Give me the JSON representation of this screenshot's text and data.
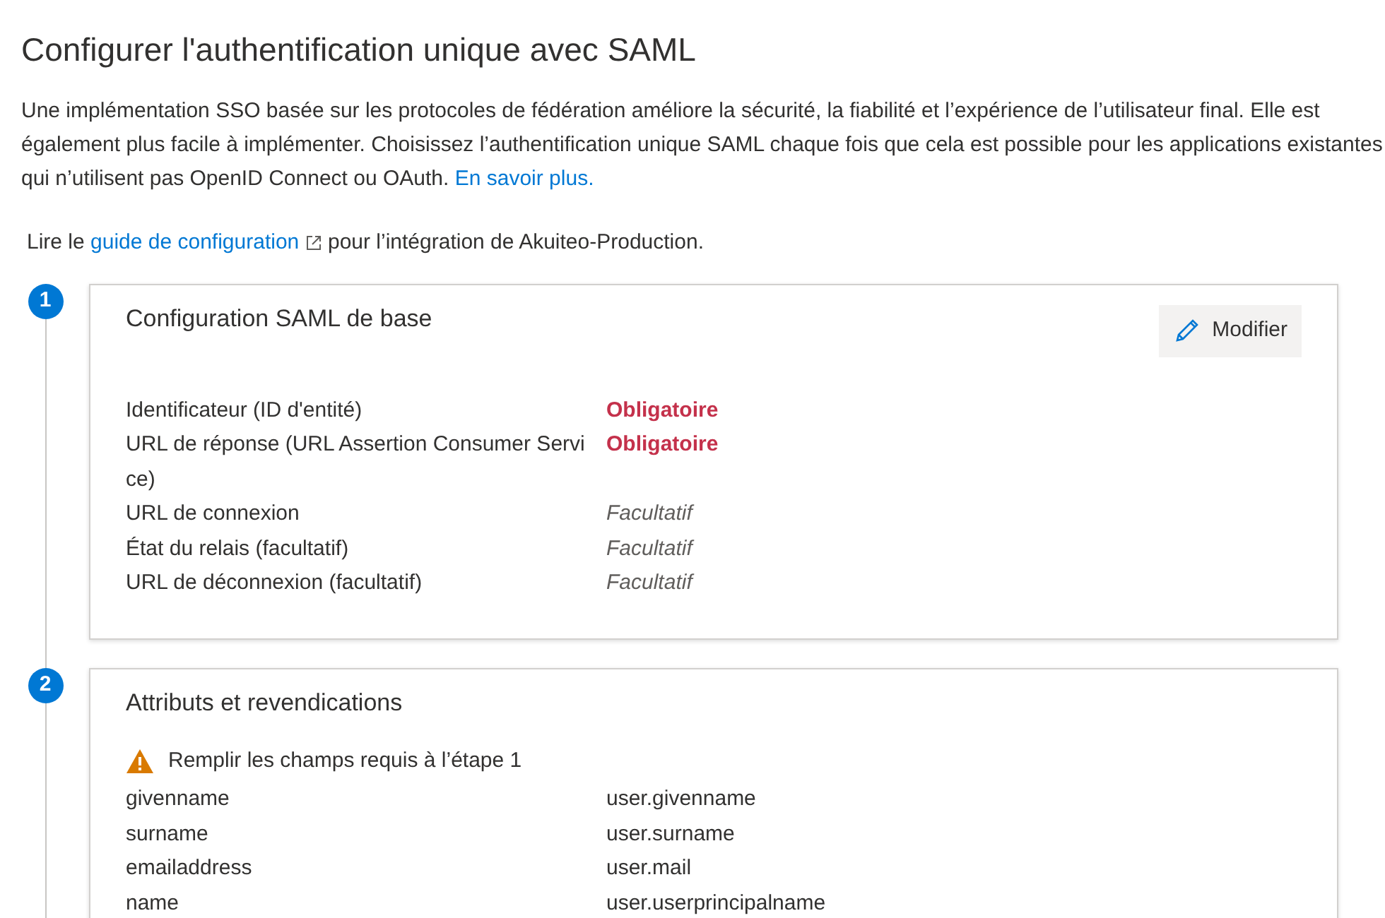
{
  "title": "Configurer l'authentification unique avec SAML",
  "description": {
    "text": "Une implémentation SSO basée sur les protocoles de fédération améliore la sécurité, la fiabilité et l’expérience de l’utilisateur final. Elle est également plus facile à implémenter. Choisissez l’authentification unique SAML chaque fois que cela est possible pour les applications existantes qui n’utilisent pas OpenID Connect ou OAuth.",
    "link": "En savoir plus."
  },
  "guide": {
    "before": "Lire le",
    "link": "guide de configuration",
    "after": "pour l’intégration de Akuiteo-Production."
  },
  "steps": [
    {
      "number": "1",
      "title": "Configuration SAML de base",
      "button": "Modifier",
      "rows": [
        {
          "label": "Identificateur (ID d'entité)",
          "value": "Obligatoire",
          "kind": "required"
        },
        {
          "label": "URL de réponse (URL Assertion Consumer Service)",
          "value": "Obligatoire",
          "kind": "required"
        },
        {
          "label": "URL de connexion",
          "value": "Facultatif",
          "kind": "optional"
        },
        {
          "label": "État du relais (facultatif)",
          "value": "Facultatif",
          "kind": "optional"
        },
        {
          "label": "URL de déconnexion (facultatif)",
          "value": "Facultatif",
          "kind": "optional"
        }
      ]
    },
    {
      "number": "2",
      "title": "Attributs et revendications",
      "warning": "Remplir les champs requis à l’étape 1",
      "rows": [
        {
          "label": "givenname",
          "value": "user.givenname",
          "kind": "plain"
        },
        {
          "label": "surname",
          "value": "user.surname",
          "kind": "plain"
        },
        {
          "label": "emailaddress",
          "value": "user.mail",
          "kind": "plain"
        },
        {
          "label": "name",
          "value": "user.userprincipalname",
          "kind": "plain"
        }
      ]
    }
  ]
}
